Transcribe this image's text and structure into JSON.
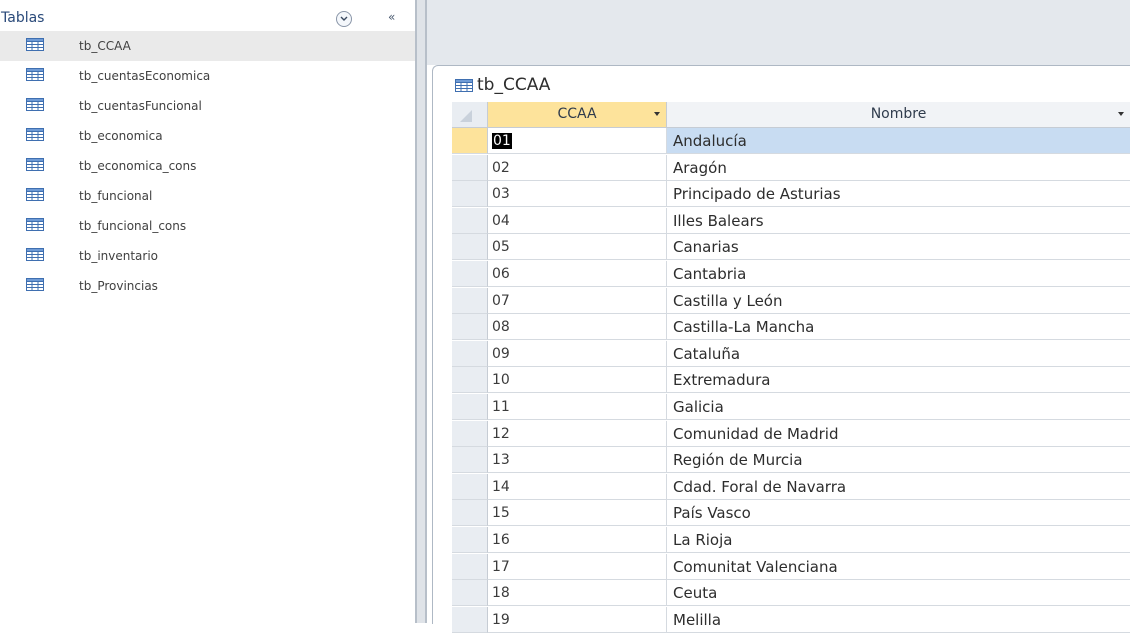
{
  "nav": {
    "title": "Tablas",
    "collapse_glyph": "«",
    "items": [
      {
        "label": "tb_CCAA",
        "icon": "table-icon",
        "selected": true
      },
      {
        "label": "tb_cuentasEconomica",
        "icon": "table-icon"
      },
      {
        "label": "tb_cuentasFuncional",
        "icon": "table-icon"
      },
      {
        "label": "tb_economica",
        "icon": "table-icon"
      },
      {
        "label": "tb_economica_cons",
        "icon": "table-icon"
      },
      {
        "label": "tb_funcional",
        "icon": "table-icon"
      },
      {
        "label": "tb_funcional_cons",
        "icon": "table-icon"
      },
      {
        "label": "tb_inventario",
        "icon": "table-icon"
      },
      {
        "label": "tb_Provincias",
        "icon": "table-icon"
      }
    ]
  },
  "document": {
    "tab_label": "tb_CCAA",
    "columns": [
      "CCAA",
      "Nombre"
    ],
    "current_row": 0,
    "rows": [
      {
        "ccaa": "01",
        "nombre": "Andalucía"
      },
      {
        "ccaa": "02",
        "nombre": "Aragón"
      },
      {
        "ccaa": "03",
        "nombre": "Principado de Asturias"
      },
      {
        "ccaa": "04",
        "nombre": "Illes Balears"
      },
      {
        "ccaa": "05",
        "nombre": "Canarias"
      },
      {
        "ccaa": "06",
        "nombre": "Cantabria"
      },
      {
        "ccaa": "07",
        "nombre": "Castilla y León"
      },
      {
        "ccaa": "08",
        "nombre": "Castilla-La Mancha"
      },
      {
        "ccaa": "09",
        "nombre": "Cataluña"
      },
      {
        "ccaa": "10",
        "nombre": "Extremadura"
      },
      {
        "ccaa": "11",
        "nombre": "Galicia"
      },
      {
        "ccaa": "12",
        "nombre": "Comunidad de Madrid"
      },
      {
        "ccaa": "13",
        "nombre": "Región de Murcia"
      },
      {
        "ccaa": "14",
        "nombre": "Cdad. Foral de Navarra"
      },
      {
        "ccaa": "15",
        "nombre": "País Vasco"
      },
      {
        "ccaa": "16",
        "nombre": "La Rioja"
      },
      {
        "ccaa": "17",
        "nombre": "Comunitat Valenciana"
      },
      {
        "ccaa": "18",
        "nombre": "Ceuta"
      },
      {
        "ccaa": "19",
        "nombre": "Melilla"
      }
    ]
  },
  "colors": {
    "accent_header": "#fde39b",
    "selected_row": "#c8dcf2",
    "nav_title": "#2a4a7a"
  }
}
